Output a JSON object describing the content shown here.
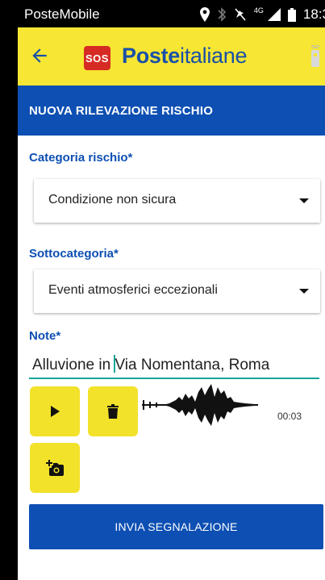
{
  "status_bar": {
    "carrier": "PosteMobile",
    "network": "4G",
    "time": "18:3"
  },
  "app_bar": {
    "badge": "SOS",
    "brand_bold": "Poste",
    "brand_regular": "italiane"
  },
  "page_title": "NUOVA RILEVAZIONE RISCHIO",
  "form": {
    "category_label": "Categoria rischio*",
    "category_value": "Condizione non sicura",
    "subcategory_label": "Sottocategoria*",
    "subcategory_value": "Eventi atmosferici eccezionali",
    "note_label": "Note*",
    "note_before_cursor": "Alluvione in ",
    "note_after_cursor": "Via Nomentana, Roma"
  },
  "audio": {
    "duration": "00:03"
  },
  "submit_label": "INVIA SEGNALAZIONE",
  "colors": {
    "primary_blue": "#0d4fb3",
    "accent_yellow": "#f7e633",
    "sos_red": "#d62b24",
    "input_underline": "#16a59a"
  },
  "icons": [
    "back-arrow-icon",
    "sos-icon",
    "beacon-icon",
    "location-icon",
    "bluetooth-icon",
    "mute-icon",
    "signal-icon",
    "battery-icon",
    "play-icon",
    "trash-icon",
    "add-photo-icon",
    "waveform"
  ]
}
